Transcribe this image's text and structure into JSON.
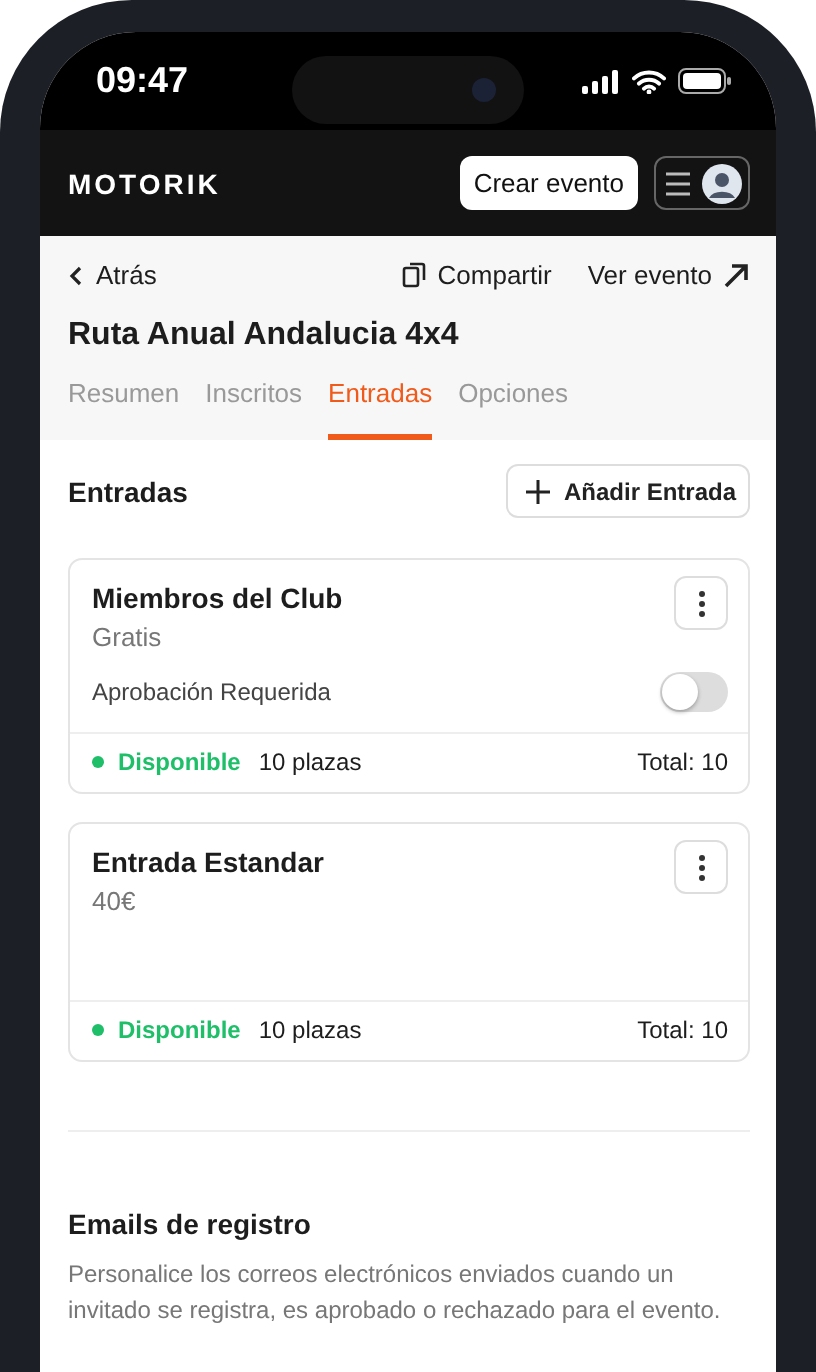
{
  "status_bar": {
    "time": "09:47"
  },
  "header": {
    "logo": "MOTORIK",
    "create_button": "Crear evento"
  },
  "nav": {
    "back": "Atrás",
    "share": "Compartir",
    "view": "Ver evento"
  },
  "title": "Ruta Anual Andalucia 4x4",
  "tabs": [
    {
      "label": "Resumen",
      "selected": false
    },
    {
      "label": "Inscritos",
      "selected": false
    },
    {
      "label": "Entradas",
      "selected": true
    },
    {
      "label": "Opciones",
      "selected": false
    }
  ],
  "tickets_section": {
    "heading": "Entradas",
    "add_button": "Añadir Entrada"
  },
  "tickets": [
    {
      "name": "Miembros del Club",
      "price": "Gratis",
      "approval": {
        "label": "Aprobación Requerida",
        "on": false
      },
      "status": "Disponible",
      "color": "#1fbf6a",
      "seats": "10 plazas",
      "total": "Total: 10"
    },
    {
      "name": "Entrada Estandar",
      "price": "40€",
      "status": "Disponible",
      "color": "#1fbf6a",
      "seats": "10 plazas",
      "total": "Total: 10"
    }
  ],
  "emails": {
    "heading": "Emails de registro",
    "description": "Personalice los correos electrónicos enviados cuando un invitado se registra, es aprobado o rechazado para el evento."
  }
}
